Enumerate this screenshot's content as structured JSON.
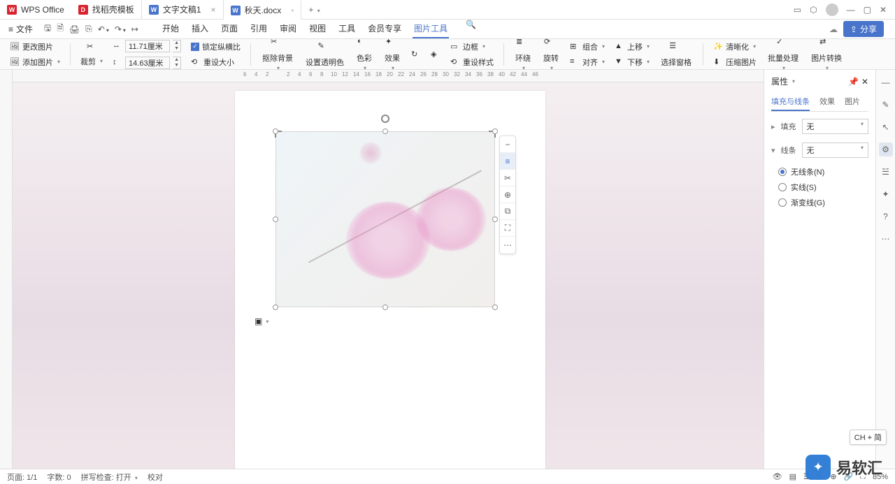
{
  "app": {
    "name": "WPS Office"
  },
  "tabs": [
    {
      "icon": "red",
      "label": "找稻壳模板"
    },
    {
      "icon": "blue",
      "label": "文字文稿1"
    },
    {
      "icon": "blue",
      "label": "秋天.docx"
    }
  ],
  "tab_add": "+",
  "menu": {
    "file": "文件",
    "items": [
      "开始",
      "插入",
      "页面",
      "引用",
      "审阅",
      "视图",
      "工具",
      "会员专享",
      "图片工具"
    ]
  },
  "share": "分享",
  "ribbon": {
    "change_img": "更改图片",
    "add_img": "添加图片",
    "crop": "裁剪",
    "width": "11.71厘米",
    "height": "14.63厘米",
    "lock_ratio": "锁定纵横比",
    "reset_size": "重设大小",
    "remove_bg": "抠除背景",
    "transparent": "设置透明色",
    "color": "色彩",
    "effect": "效果",
    "border": "边框",
    "preset": "重设样式",
    "wrap": "环绕",
    "rotate": "旋转",
    "group": "组合",
    "align": "对齐",
    "up": "上移",
    "down": "下移",
    "sel_pane": "选择窗格",
    "clarity": "清晰化",
    "compress": "压缩图片",
    "batch": "批量处理",
    "convert": "图片转换"
  },
  "ruler_h": [
    "6",
    "4",
    "2",
    "2",
    "4",
    "6",
    "8",
    "10",
    "12",
    "14",
    "16",
    "18",
    "20",
    "22",
    "24",
    "26",
    "28",
    "30",
    "32",
    "34",
    "36",
    "38",
    "40",
    "42",
    "44",
    "46"
  ],
  "float_tb": [
    "−",
    "≡",
    "✂",
    "⊕",
    "⧉",
    "⛶",
    "⋯"
  ],
  "props": {
    "title": "属性",
    "tabs": [
      "填充与线条",
      "效果",
      "图片"
    ],
    "fill": "填充",
    "line": "线条",
    "none": "无",
    "radios": {
      "no_line": "无线条(N)",
      "solid": "实线(S)",
      "gradient": "渐变线(G)"
    }
  },
  "status": {
    "page": "页面: 1/1",
    "words": "字数: 0",
    "spell": "拼写检查: 打开",
    "proof": "校对",
    "zoom_end": "85%"
  },
  "ime": "CH ⌖ 简",
  "watermark": "易软汇"
}
